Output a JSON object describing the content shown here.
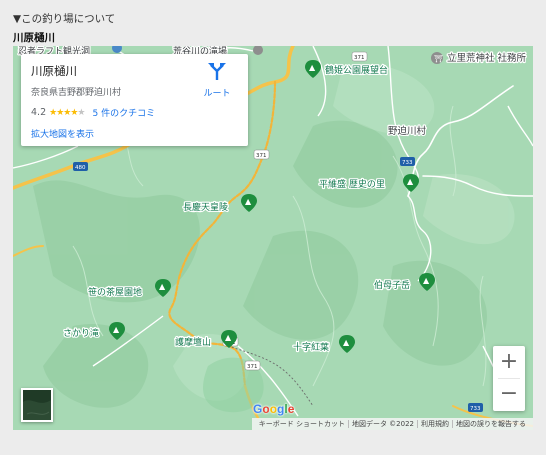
{
  "header": {
    "section_toggle": "▼この釣り場について",
    "place_name": "川原樋川"
  },
  "info_card": {
    "title": "川原樋川",
    "address": "奈良県吉野郡野迫川村",
    "rating": "4.2",
    "rating_stars": 4,
    "rating_max": 5,
    "reviews_link": "5 件のクチコミ",
    "larger_map_link": "拡大地図を表示",
    "directions_label": "ルート"
  },
  "map": {
    "pois": [
      {
        "name": "鶴姫公園展望台",
        "icon": "park-pin-icon"
      },
      {
        "name": "平維盛 歴史の里",
        "icon": "park-pin-icon"
      },
      {
        "name": "長慶天皇陵",
        "icon": "park-pin-icon"
      },
      {
        "name": "笹の茶屋園地",
        "icon": "park-pin-icon"
      },
      {
        "name": "伯母子岳",
        "icon": "park-pin-icon"
      },
      {
        "name": "さかり滝",
        "icon": "park-pin-icon"
      },
      {
        "name": "護摩壇山",
        "icon": "park-pin-icon"
      },
      {
        "name": "十字紅葉",
        "icon": "park-pin-icon"
      }
    ],
    "places": [
      {
        "name": "野迫川村"
      },
      {
        "name": "立里荒神社 社務所"
      }
    ],
    "top_fragments": {
      "left": "忍者ラフト観光洞",
      "center": "荒谷川の滝場"
    },
    "route_shields": [
      "371",
      "371",
      "371",
      "371",
      "733",
      "733",
      "480"
    ],
    "google_logo": "Google",
    "controls": {
      "zoom_in": "+",
      "zoom_out": "−"
    },
    "attribution": {
      "keyboard_shortcuts": "キーボード ショートカット",
      "map_data": "地図データ ©2022",
      "terms": "利用規約",
      "report_error": "地図の誤りを報告する"
    },
    "colors": {
      "terrain": "#a8d8b5",
      "road_yellow": "#f5c34a",
      "road_white": "#ffffff",
      "poi_green": "#1e8e3e",
      "route_pin": "#1a73e8"
    }
  }
}
